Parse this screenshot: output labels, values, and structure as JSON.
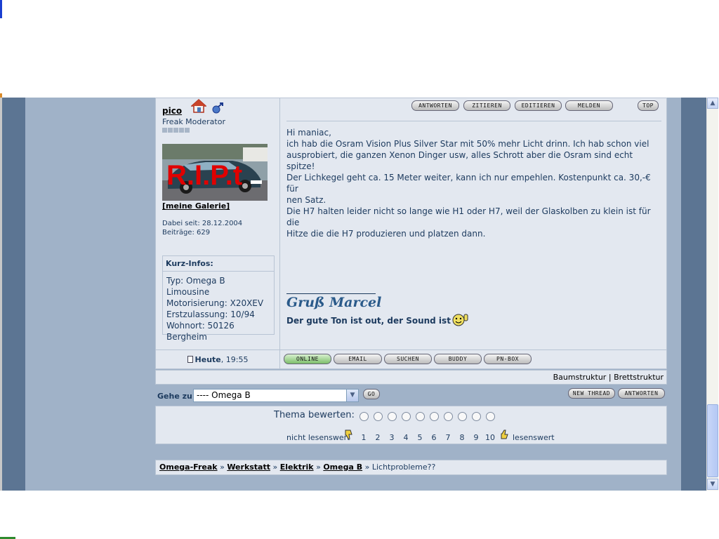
{
  "post": {
    "username": "pico",
    "rank": "Freak Moderator",
    "avatar_text": "R.I.P.t",
    "gallery_link": "[meine Galerie]",
    "joined": "Dabei seit: 28.12.2004",
    "posts": "Beiträge: 629",
    "kurz_title": "Kurz-Infos:",
    "kurz_lines": [
      "Typ: Omega B Limousine",
      "Motorisierung: X20XEV",
      "Erstzulassung: 10/94",
      "Wohnort: 50126",
      "Bergheim"
    ],
    "buttons": [
      "ANTWORTEN",
      "ZITIEREN",
      "EDITIEREN",
      "MELDEN",
      "TOP"
    ],
    "message_lines": [
      "Hi maniac,",
      "ich hab die Osram Vision Plus Silver Star mit 50% mehr Licht drinn. Ich hab schon viel",
      "ausprobiert, die ganzen Xenon Dinger usw, alles Schrott aber die Osram sind echt spitze!",
      "Der Lichkegel geht ca. 15 Meter weiter, kann ich nur empehlen. Kostenpunkt ca. 30,-€ für",
      "nen Satz.",
      "Die H7 halten leider nicht so lange wie H1 oder H7, weil der Glaskolben zu klein ist für die",
      "Hitze die die H7 produzieren und platzen dann."
    ],
    "signature_name": "Gruß Marcel",
    "signature_text": "Der gute Ton ist out, der Sound ist in",
    "date_bold": "Heute",
    "date_rest": ", 19:55",
    "footer_buttons": [
      "ONLINE",
      "EMAIL",
      "SUCHEN",
      "BUDDY",
      "PN-BOX"
    ]
  },
  "treebar": {
    "baum": "Baumstruktur",
    "sep": "|",
    "brett": "Brettstruktur"
  },
  "goto": {
    "label": "Gehe zu:",
    "selected": "---- Omega B",
    "go": "GO",
    "new_thread": "NEW THREAD",
    "reply": "ANTWORTEN"
  },
  "rating": {
    "label": "Thema bewerten:",
    "low": "nicht lesenswert",
    "high": "lesenswert",
    "numbers": [
      "1",
      "2",
      "3",
      "4",
      "5",
      "6",
      "7",
      "8",
      "9",
      "10"
    ]
  },
  "breadcrumb": {
    "items": [
      "Omega-Freak",
      "Werkstatt",
      "Elektrik",
      "Omega B"
    ],
    "sep": "»",
    "current": "Lichtprobleme??"
  },
  "colors": {
    "frame": "#5c7593",
    "panel": "#a0b2c8",
    "cell": "#e3e8f0",
    "text": "#1c3a5e"
  }
}
